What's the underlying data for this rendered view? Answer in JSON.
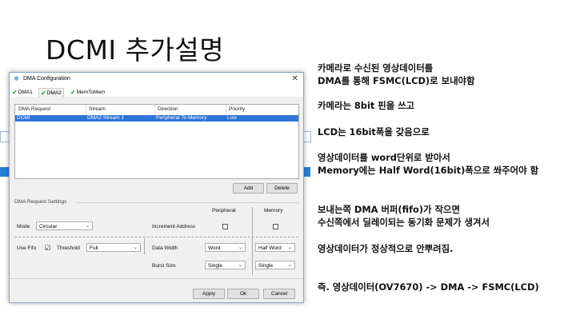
{
  "slide": {
    "title": "DCMI 추가설명",
    "notes": [
      "카메라로 수신된  영상데이터를",
      "DMA를 통해 FSMC(LCD)로 보내야함",
      "카메라는 8bit 핀을 쓰고",
      "LCD는 16bit폭을 갖음으로",
      "영상데이터를  word단위로 받아서",
      "Memory에는 Half Word(16bit)폭으로 쏴주어야 함",
      "보내는쪽 DMA 버퍼(fifo)가 작으면",
      "수신쪽에서 딜레이되는 동기화 문제가 생겨서",
      "영상데이터가 정상적으로 안뿌려짐.",
      "즉.   영상데이터(OV7670) -> DMA -> FSMC(LCD)"
    ]
  },
  "dialog": {
    "title": "DMA Configuration",
    "close_glyph": "✕",
    "app_icon_glyph": "❋",
    "tabs": [
      "DMA1",
      "DMA2",
      "MemToMem"
    ],
    "check_glyph": "✔",
    "table": {
      "headers": [
        "DMA Request",
        "Stream",
        "Direction",
        "Priority"
      ],
      "rows": [
        [
          "DCMI",
          "DMA2 Stream 1",
          "Peripheral To Memory",
          "Low"
        ]
      ]
    },
    "add_label": "Add",
    "delete_label": "Delete",
    "settings_label": "DMA Request Settings",
    "peripheral_label": "Peripheral",
    "memory_label": "Memory",
    "mode_label": "Mode",
    "mode_value": "Circular",
    "increment_label": "Increment Address",
    "use_fifo_label": "Use Fifo",
    "use_fifo_checked": "☑",
    "threshold_label": "Threshold",
    "threshold_value": "Full",
    "data_width_label": "Data Width",
    "data_width_peripheral": "Word",
    "data_width_memory": "Half Word",
    "burst_size_label": "Burst Size",
    "burst_peripheral": "Single",
    "burst_memory": "Single",
    "apply_label": "Apply",
    "ok_label": "Ok",
    "cancel_label": "Cancel",
    "dropdown_arrow": "⌄"
  },
  "colors": {
    "selection": "#2e74d8",
    "accent_icon": "#2e8bdc",
    "check_green": "#1e9b2e"
  }
}
